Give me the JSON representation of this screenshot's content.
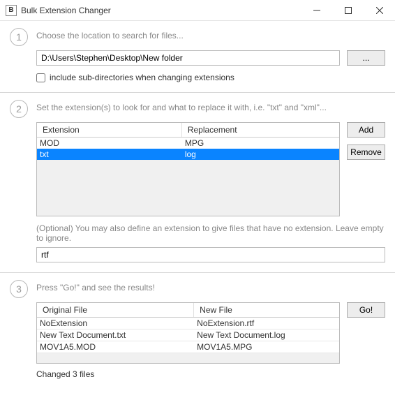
{
  "window": {
    "title": "Bulk Extension Changer"
  },
  "step1": {
    "desc": "Choose the location to search for files...",
    "path": "D:\\Users\\Stephen\\Desktop\\New folder",
    "browse_label": "...",
    "include_sub_label": "include sub-directories when changing extensions"
  },
  "step2": {
    "desc": "Set the extension(s) to look for and what to replace it with, i.e. \"txt\" and \"xml\"...",
    "col_ext": "Extension",
    "col_repl": "Replacement",
    "rows": [
      {
        "ext": "MOD",
        "repl": "MPG",
        "selected": false
      },
      {
        "ext": "txt",
        "repl": "log",
        "selected": true
      }
    ],
    "add_label": "Add",
    "remove_label": "Remove",
    "optional_note": "(Optional) You may also define an extension to give files that have no extension. Leave empty to ignore.",
    "noext_value": "rtf"
  },
  "step3": {
    "desc": "Press \"Go!\" and see the results!",
    "col_orig": "Original File",
    "col_new": "New File",
    "rows": [
      {
        "orig": "NoExtension",
        "new": "NoExtension.rtf"
      },
      {
        "orig": "New Text Document.txt",
        "new": "New Text Document.log"
      },
      {
        "orig": "MOV1A5.MOD",
        "new": "MOV1A5.MPG"
      }
    ],
    "go_label": "Go!",
    "status": "Changed 3 files"
  }
}
